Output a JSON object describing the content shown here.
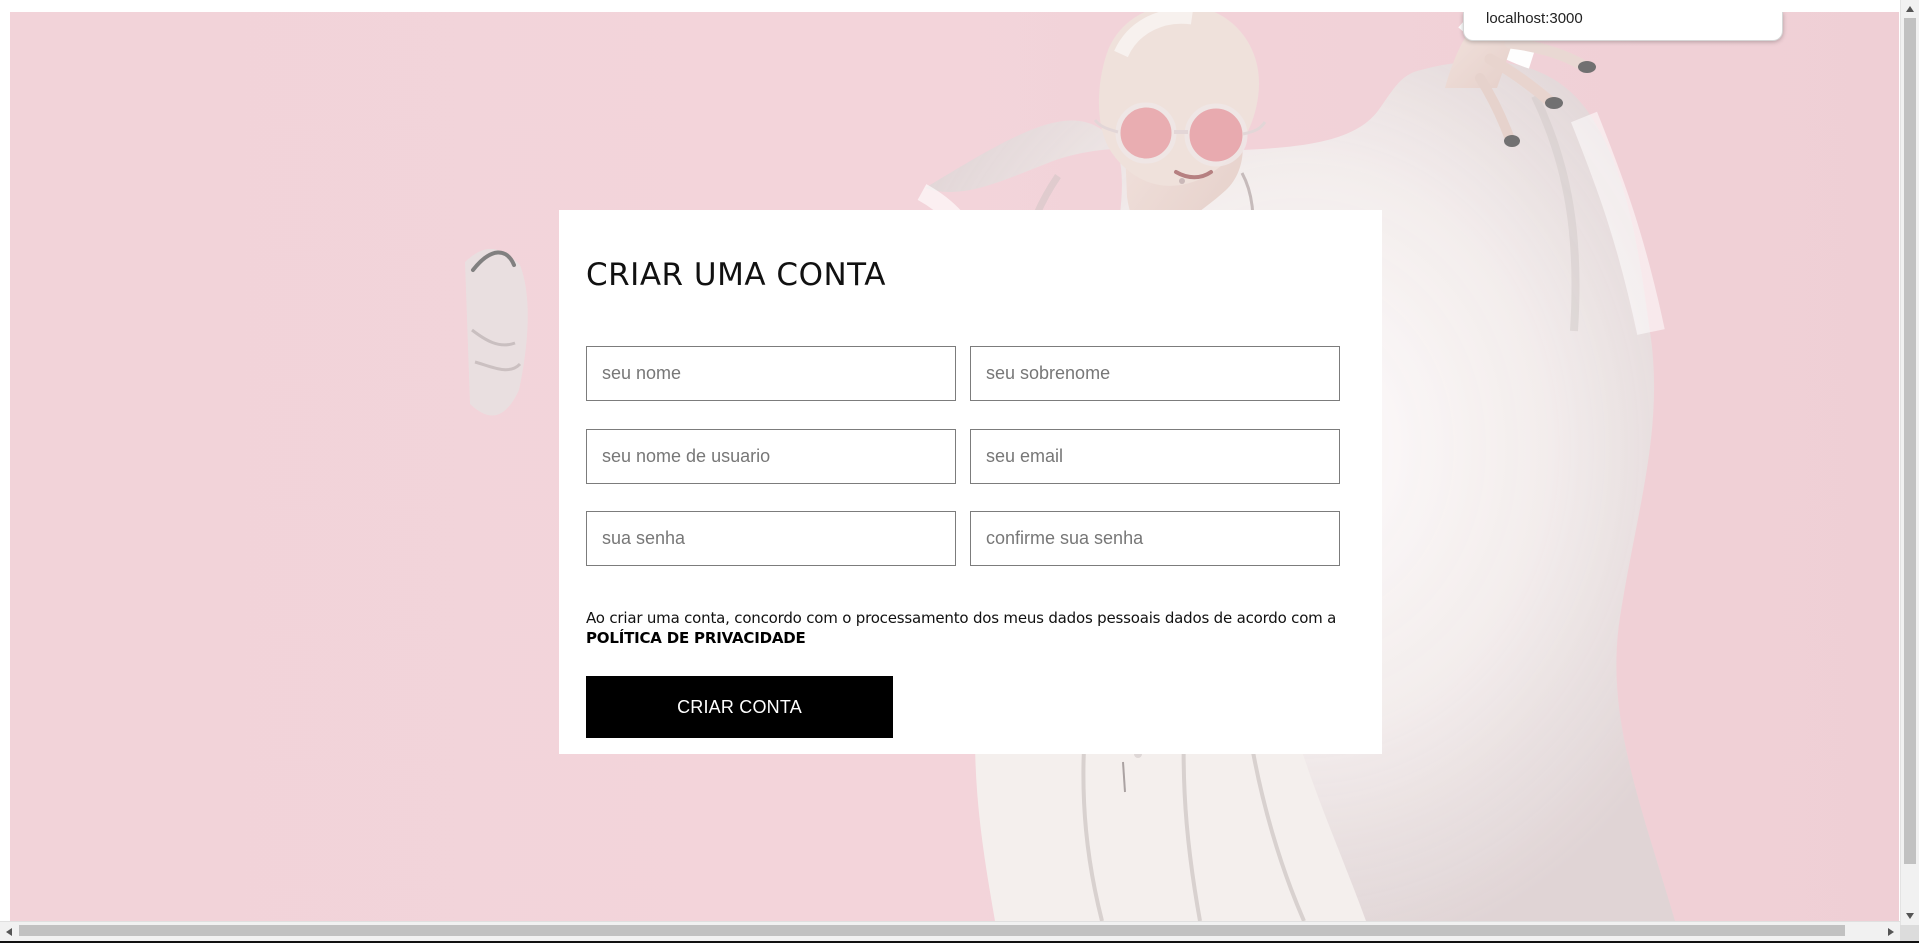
{
  "browser": {
    "origin_popup_text": "localhost:3000"
  },
  "signup": {
    "title": "CRIAR UMA CONTA",
    "fields": {
      "first_name_placeholder": "seu nome",
      "last_name_placeholder": "seu sobrenome",
      "username_placeholder": "seu nome de usuario",
      "email_placeholder": "seu email",
      "password_placeholder": "sua senha",
      "confirm_password_placeholder": "confirme sua senha"
    },
    "consent_text": "Ao criar uma conta, concordo com o processamento dos meus dados pessoais dados de acordo com a ",
    "privacy_link": "POLÍTICA DE PRIVACIDADE",
    "submit_label": "CRIAR CONTA"
  },
  "colors": {
    "background_pink": "#f2d2d8",
    "card_background": "#ffffff",
    "button_background": "#000000",
    "button_text": "#ffffff"
  }
}
